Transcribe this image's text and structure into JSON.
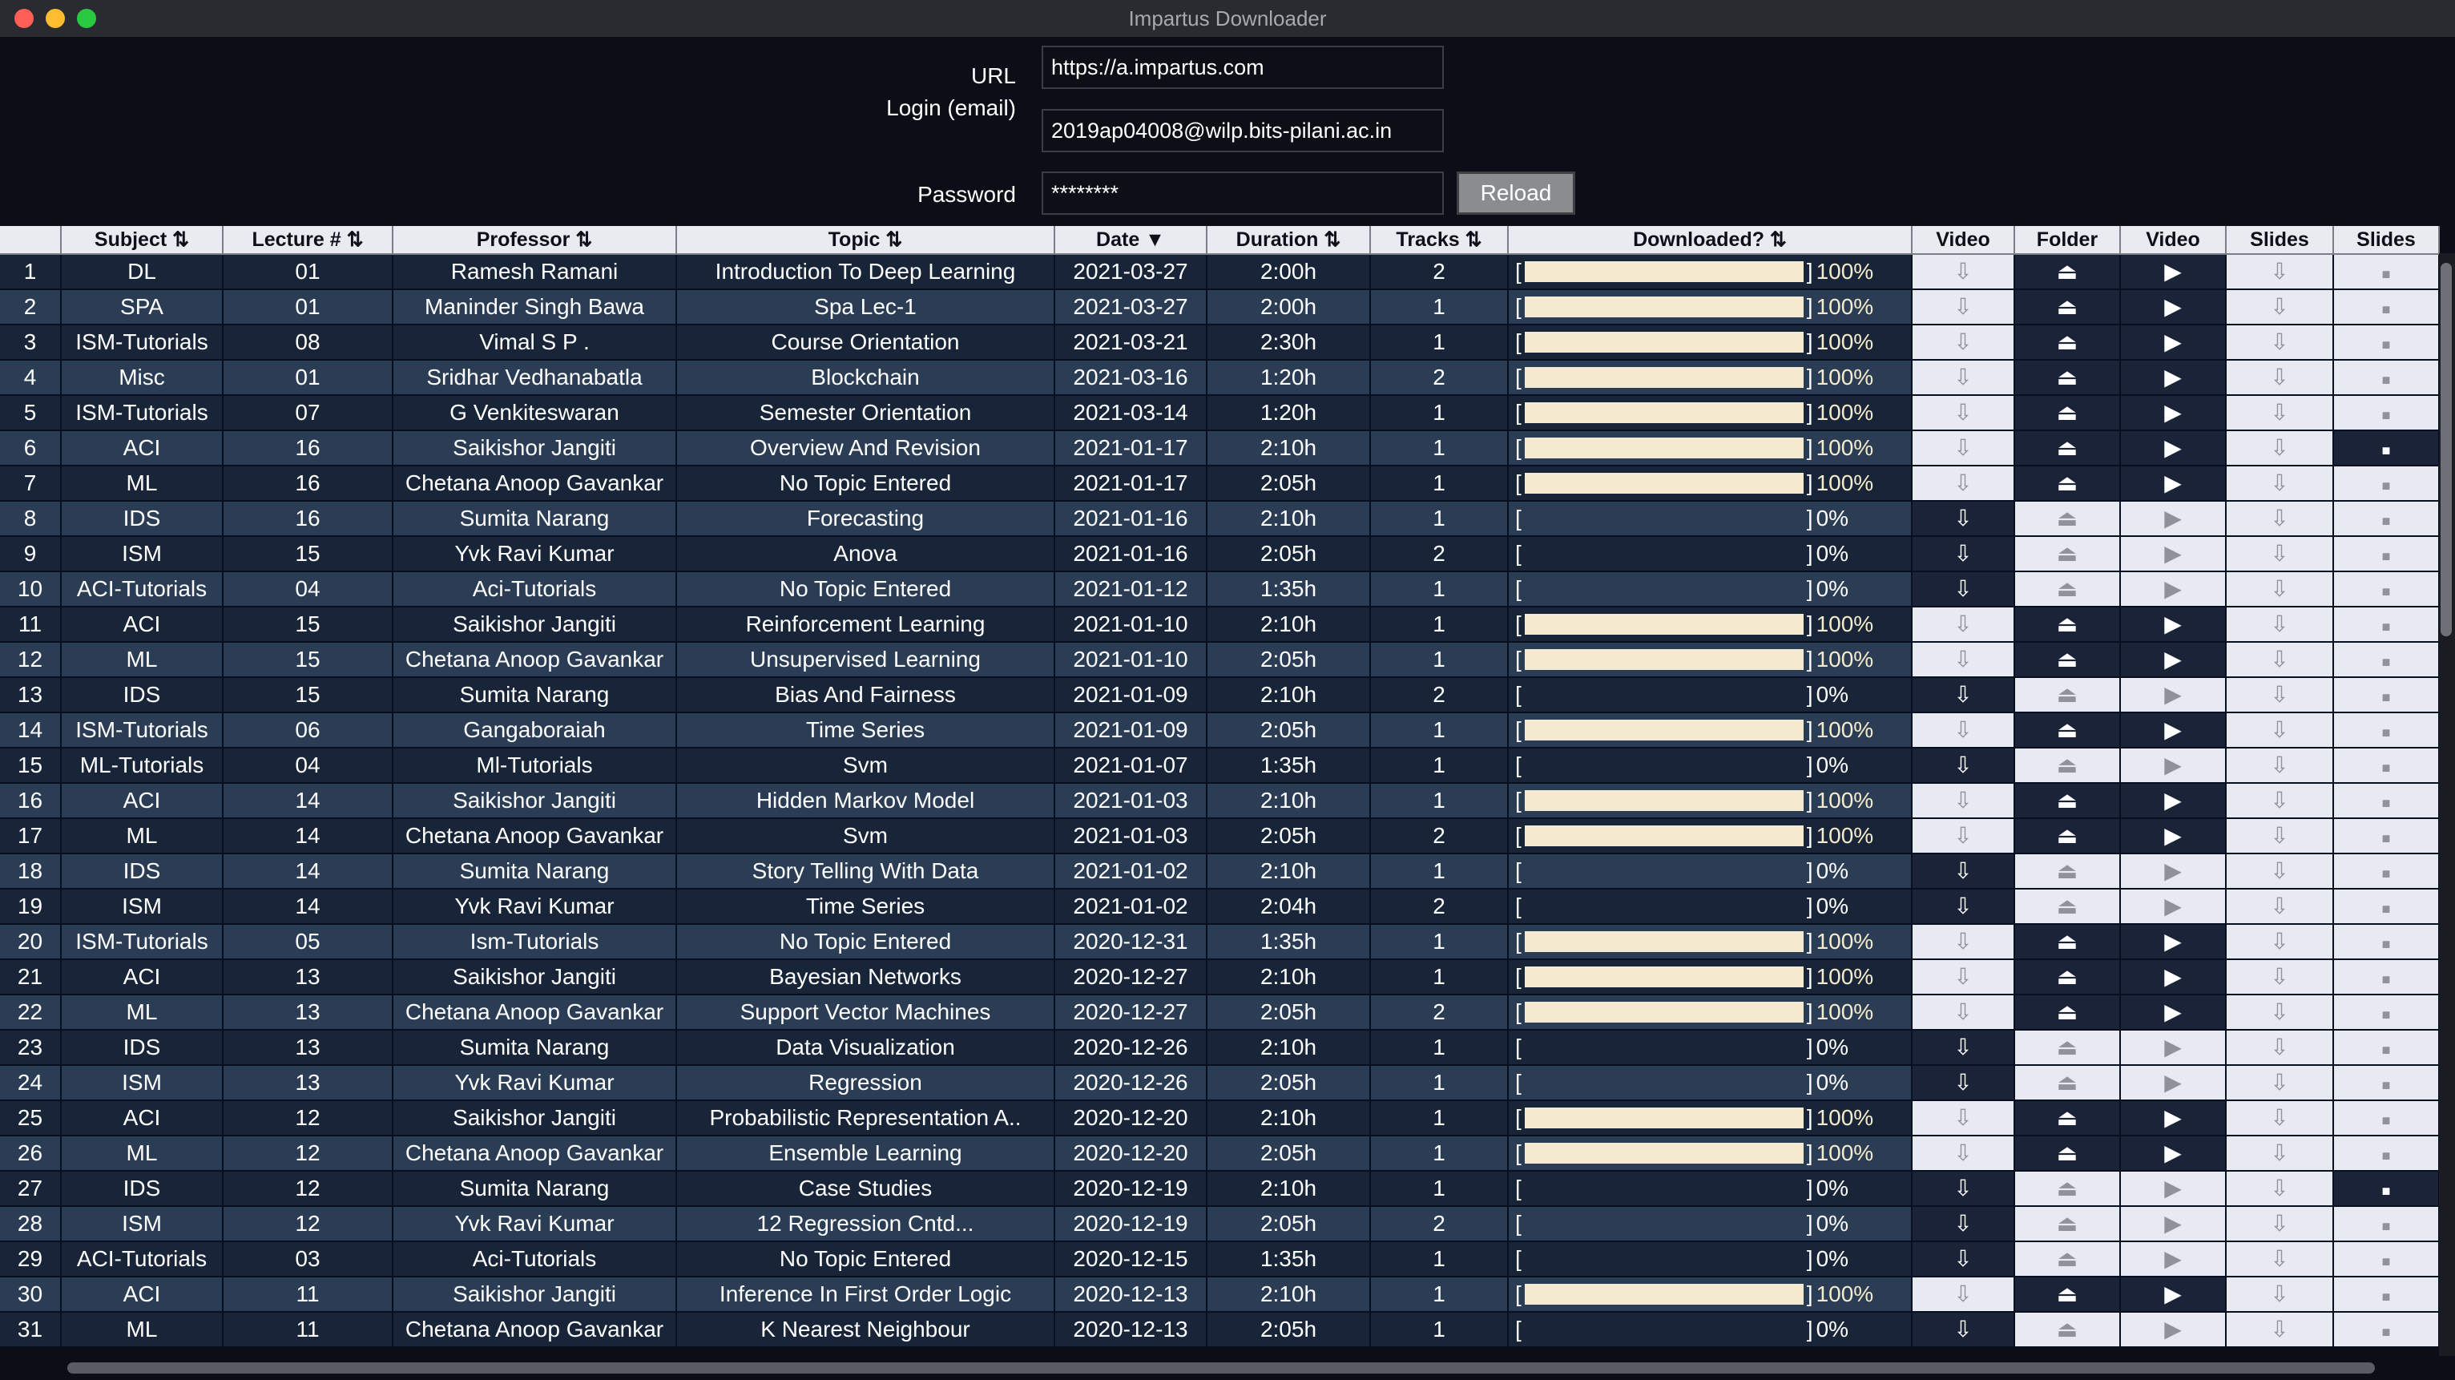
{
  "window": {
    "title": "Impartus Downloader"
  },
  "form": {
    "url_label": "URL",
    "url_value": "https://a.impartus.com",
    "login_label": "Login (email)",
    "login_value": "2019ap04008@wilp.bits-pilani.ac.in",
    "password_label": "Password",
    "password_value": "********",
    "reload_label": "Reload"
  },
  "table": {
    "columns": [
      "",
      "Subject ⇅",
      "Lecture # ⇅",
      "Professor ⇅",
      "Topic ⇅",
      "Date ▼",
      "Duration ⇅",
      "Tracks ⇅",
      "Downloaded? ⇅",
      "Video",
      "Folder",
      "Video",
      "Slides",
      "Slides"
    ],
    "icons": {
      "download": "download-icon",
      "folder": "eject-folder-icon",
      "play": "play-icon",
      "slides_download": "download-icon",
      "slides_open": "square-icon"
    },
    "bracket_open": "[",
    "bracket_close": "]",
    "rows": [
      {
        "n": "1",
        "subject": "DL",
        "lecture": "01",
        "professor": "Ramesh Ramani",
        "topic": "Introduction To Deep Learning",
        "date": "2021-03-27",
        "duration": "2:00h",
        "tracks": "2",
        "progress": 100,
        "pct": "100%",
        "slides": false
      },
      {
        "n": "2",
        "subject": "SPA",
        "lecture": "01",
        "professor": "Maninder Singh Bawa",
        "topic": "Spa Lec-1",
        "date": "2021-03-27",
        "duration": "2:00h",
        "tracks": "1",
        "progress": 100,
        "pct": "100%",
        "slides": false
      },
      {
        "n": "3",
        "subject": "ISM-Tutorials",
        "lecture": "08",
        "professor": "Vimal S P .",
        "topic": "Course Orientation",
        "date": "2021-03-21",
        "duration": "2:30h",
        "tracks": "1",
        "progress": 100,
        "pct": "100%",
        "slides": false
      },
      {
        "n": "4",
        "subject": "Misc",
        "lecture": "01",
        "professor": "Sridhar Vedhanabatla",
        "topic": "Blockchain",
        "date": "2021-03-16",
        "duration": "1:20h",
        "tracks": "2",
        "progress": 100,
        "pct": "100%",
        "slides": false
      },
      {
        "n": "5",
        "subject": "ISM-Tutorials",
        "lecture": "07",
        "professor": "G Venkiteswaran",
        "topic": "Semester Orientation",
        "date": "2021-03-14",
        "duration": "1:20h",
        "tracks": "1",
        "progress": 100,
        "pct": "100%",
        "slides": false
      },
      {
        "n": "6",
        "subject": "ACI",
        "lecture": "16",
        "professor": "Saikishor Jangiti",
        "topic": "Overview And Revision",
        "date": "2021-01-17",
        "duration": "2:10h",
        "tracks": "1",
        "progress": 100,
        "pct": "100%",
        "slides": true
      },
      {
        "n": "7",
        "subject": "ML",
        "lecture": "16",
        "professor": "Chetana Anoop Gavankar",
        "topic": "No Topic Entered",
        "date": "2021-01-17",
        "duration": "2:05h",
        "tracks": "1",
        "progress": 100,
        "pct": "100%",
        "slides": false
      },
      {
        "n": "8",
        "subject": "IDS",
        "lecture": "16",
        "professor": "Sumita Narang",
        "topic": "Forecasting",
        "date": "2021-01-16",
        "duration": "2:10h",
        "tracks": "1",
        "progress": 0,
        "pct": "0%",
        "slides": false
      },
      {
        "n": "9",
        "subject": "ISM",
        "lecture": "15",
        "professor": "Yvk  Ravi Kumar",
        "topic": "Anova",
        "date": "2021-01-16",
        "duration": "2:05h",
        "tracks": "2",
        "progress": 0,
        "pct": "0%",
        "slides": false
      },
      {
        "n": "10",
        "subject": "ACI-Tutorials",
        "lecture": "04",
        "professor": "Aci-Tutorials",
        "topic": "No Topic Entered",
        "date": "2021-01-12",
        "duration": "1:35h",
        "tracks": "1",
        "progress": 0,
        "pct": "0%",
        "slides": false
      },
      {
        "n": "11",
        "subject": "ACI",
        "lecture": "15",
        "professor": "Saikishor Jangiti",
        "topic": "Reinforcement Learning",
        "date": "2021-01-10",
        "duration": "2:10h",
        "tracks": "1",
        "progress": 100,
        "pct": "100%",
        "slides": false
      },
      {
        "n": "12",
        "subject": "ML",
        "lecture": "15",
        "professor": "Chetana Anoop Gavankar",
        "topic": "Unsupervised Learning",
        "date": "2021-01-10",
        "duration": "2:05h",
        "tracks": "1",
        "progress": 100,
        "pct": "100%",
        "slides": false
      },
      {
        "n": "13",
        "subject": "IDS",
        "lecture": "15",
        "professor": "Sumita Narang",
        "topic": "Bias And Fairness",
        "date": "2021-01-09",
        "duration": "2:10h",
        "tracks": "2",
        "progress": 0,
        "pct": "0%",
        "slides": false
      },
      {
        "n": "14",
        "subject": "ISM-Tutorials",
        "lecture": "06",
        "professor": "Gangaboraiah",
        "topic": "Time Series",
        "date": "2021-01-09",
        "duration": "2:05h",
        "tracks": "1",
        "progress": 100,
        "pct": "100%",
        "slides": false
      },
      {
        "n": "15",
        "subject": "ML-Tutorials",
        "lecture": "04",
        "professor": "Ml-Tutorials",
        "topic": "Svm",
        "date": "2021-01-07",
        "duration": "1:35h",
        "tracks": "1",
        "progress": 0,
        "pct": "0%",
        "slides": false
      },
      {
        "n": "16",
        "subject": "ACI",
        "lecture": "14",
        "professor": "Saikishor Jangiti",
        "topic": "Hidden Markov Model",
        "date": "2021-01-03",
        "duration": "2:10h",
        "tracks": "1",
        "progress": 100,
        "pct": "100%",
        "slides": false
      },
      {
        "n": "17",
        "subject": "ML",
        "lecture": "14",
        "professor": "Chetana Anoop Gavankar",
        "topic": "Svm",
        "date": "2021-01-03",
        "duration": "2:05h",
        "tracks": "2",
        "progress": 100,
        "pct": "100%",
        "slides": false
      },
      {
        "n": "18",
        "subject": "IDS",
        "lecture": "14",
        "professor": "Sumita Narang",
        "topic": "Story Telling With Data",
        "date": "2021-01-02",
        "duration": "2:10h",
        "tracks": "1",
        "progress": 0,
        "pct": "0%",
        "slides": false
      },
      {
        "n": "19",
        "subject": "ISM",
        "lecture": "14",
        "professor": "Yvk  Ravi Kumar",
        "topic": "Time Series",
        "date": "2021-01-02",
        "duration": "2:04h",
        "tracks": "2",
        "progress": 0,
        "pct": "0%",
        "slides": false
      },
      {
        "n": "20",
        "subject": "ISM-Tutorials",
        "lecture": "05",
        "professor": "Ism-Tutorials",
        "topic": "No Topic Entered",
        "date": "2020-12-31",
        "duration": "1:35h",
        "tracks": "1",
        "progress": 100,
        "pct": "100%",
        "slides": false
      },
      {
        "n": "21",
        "subject": "ACI",
        "lecture": "13",
        "professor": "Saikishor Jangiti",
        "topic": "Bayesian Networks",
        "date": "2020-12-27",
        "duration": "2:10h",
        "tracks": "1",
        "progress": 100,
        "pct": "100%",
        "slides": false
      },
      {
        "n": "22",
        "subject": "ML",
        "lecture": "13",
        "professor": "Chetana Anoop Gavankar",
        "topic": "Support Vector Machines",
        "date": "2020-12-27",
        "duration": "2:05h",
        "tracks": "2",
        "progress": 100,
        "pct": "100%",
        "slides": false
      },
      {
        "n": "23",
        "subject": "IDS",
        "lecture": "13",
        "professor": "Sumita Narang",
        "topic": "Data Visualization",
        "date": "2020-12-26",
        "duration": "2:10h",
        "tracks": "1",
        "progress": 0,
        "pct": "0%",
        "slides": false
      },
      {
        "n": "24",
        "subject": "ISM",
        "lecture": "13",
        "professor": "Yvk  Ravi Kumar",
        "topic": "Regression",
        "date": "2020-12-26",
        "duration": "2:05h",
        "tracks": "1",
        "progress": 0,
        "pct": "0%",
        "slides": false
      },
      {
        "n": "25",
        "subject": "ACI",
        "lecture": "12",
        "professor": "Saikishor Jangiti",
        "topic": "Probabilistic Representation A..",
        "date": "2020-12-20",
        "duration": "2:10h",
        "tracks": "1",
        "progress": 100,
        "pct": "100%",
        "slides": false
      },
      {
        "n": "26",
        "subject": "ML",
        "lecture": "12",
        "professor": "Chetana Anoop Gavankar",
        "topic": "Ensemble Learning",
        "date": "2020-12-20",
        "duration": "2:05h",
        "tracks": "1",
        "progress": 100,
        "pct": "100%",
        "slides": false
      },
      {
        "n": "27",
        "subject": "IDS",
        "lecture": "12",
        "professor": "Sumita Narang",
        "topic": "Case Studies",
        "date": "2020-12-19",
        "duration": "2:10h",
        "tracks": "1",
        "progress": 0,
        "pct": "0%",
        "slides": true
      },
      {
        "n": "28",
        "subject": "ISM",
        "lecture": "12",
        "professor": "Yvk  Ravi Kumar",
        "topic": "12 Regression Cntd...",
        "date": "2020-12-19",
        "duration": "2:05h",
        "tracks": "2",
        "progress": 0,
        "pct": "0%",
        "slides": false
      },
      {
        "n": "29",
        "subject": "ACI-Tutorials",
        "lecture": "03",
        "professor": "Aci-Tutorials",
        "topic": "No Topic Entered",
        "date": "2020-12-15",
        "duration": "1:35h",
        "tracks": "1",
        "progress": 0,
        "pct": "0%",
        "slides": false
      },
      {
        "n": "30",
        "subject": "ACI",
        "lecture": "11",
        "professor": "Saikishor Jangiti",
        "topic": "Inference In First Order Logic",
        "date": "2020-12-13",
        "duration": "2:10h",
        "tracks": "1",
        "progress": 100,
        "pct": "100%",
        "slides": false
      },
      {
        "n": "31",
        "subject": "ML",
        "lecture": "11",
        "professor": "Chetana Anoop Gavankar",
        "topic": "K  Nearest Neighbour",
        "date": "2020-12-13",
        "duration": "2:05h",
        "tracks": "1",
        "progress": 0,
        "pct": "0%",
        "slides": false
      }
    ]
  }
}
